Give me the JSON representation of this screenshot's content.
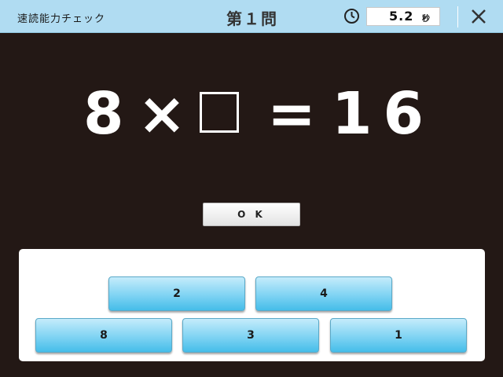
{
  "header": {
    "app_title": "速読能力チェック",
    "question_title": "第１問",
    "timer_value": "5.2",
    "timer_unit": "秒",
    "timer_icon": "clock-icon",
    "close_icon": "close-icon"
  },
  "equation": {
    "left_operand": "8",
    "operator": "×",
    "blank": "□",
    "equals": "=",
    "result": "16"
  },
  "ok_label": "O K",
  "answers": {
    "row1": [
      "2",
      "4"
    ],
    "row2": [
      "8",
      "3",
      "1"
    ]
  },
  "colors": {
    "background": "#231815",
    "header": "#b0dcf2",
    "answer_button": "#7fd3f3"
  }
}
